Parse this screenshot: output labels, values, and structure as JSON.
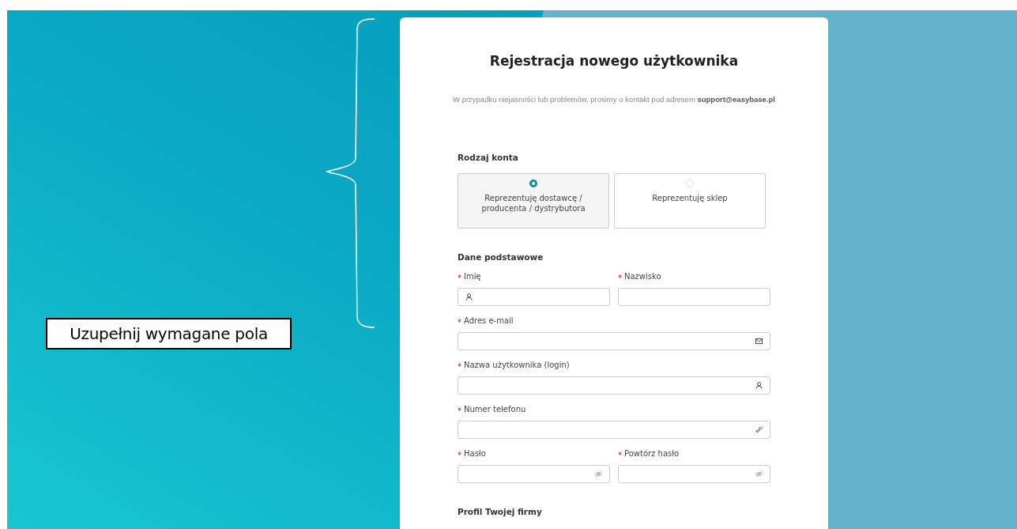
{
  "annotation": {
    "callout": "Uzupełnij wymagane pola"
  },
  "form": {
    "title": "Rejestracja nowego użytkownika",
    "help": "W przypadku niejasności lub problemów, prosimy o kontakt pod adresem **support@easybase.pl**",
    "account_type": {
      "heading": "Rodzaj konta",
      "options": [
        {
          "label": "Reprezentuję dostawcę / producenta / dystrybutora",
          "selected": true
        },
        {
          "label": "Reprezentuję sklep",
          "selected": false
        }
      ]
    },
    "basic": {
      "heading": "Dane podstawowe",
      "rows": [
        [
          {
            "kind": "name",
            "label": "Imię",
            "required": true
          },
          {
            "kind": "text",
            "label": "Nazwisko",
            "required": true
          }
        ],
        [
          {
            "kind": "email",
            "label": "Adres e-mail",
            "required": true
          }
        ],
        [
          {
            "kind": "login",
            "label": "Nazwa użytkownika (login)",
            "required": true
          }
        ],
        [
          {
            "kind": "phone",
            "label": "Numer telefonu",
            "required": true
          }
        ],
        [
          {
            "kind": "password",
            "label": "Hasło",
            "required": true
          },
          {
            "kind": "password",
            "label": "Powtórz hasło",
            "required": true
          }
        ]
      ]
    },
    "next_section": {
      "heading": "Profil Twojej firmy"
    }
  }
}
